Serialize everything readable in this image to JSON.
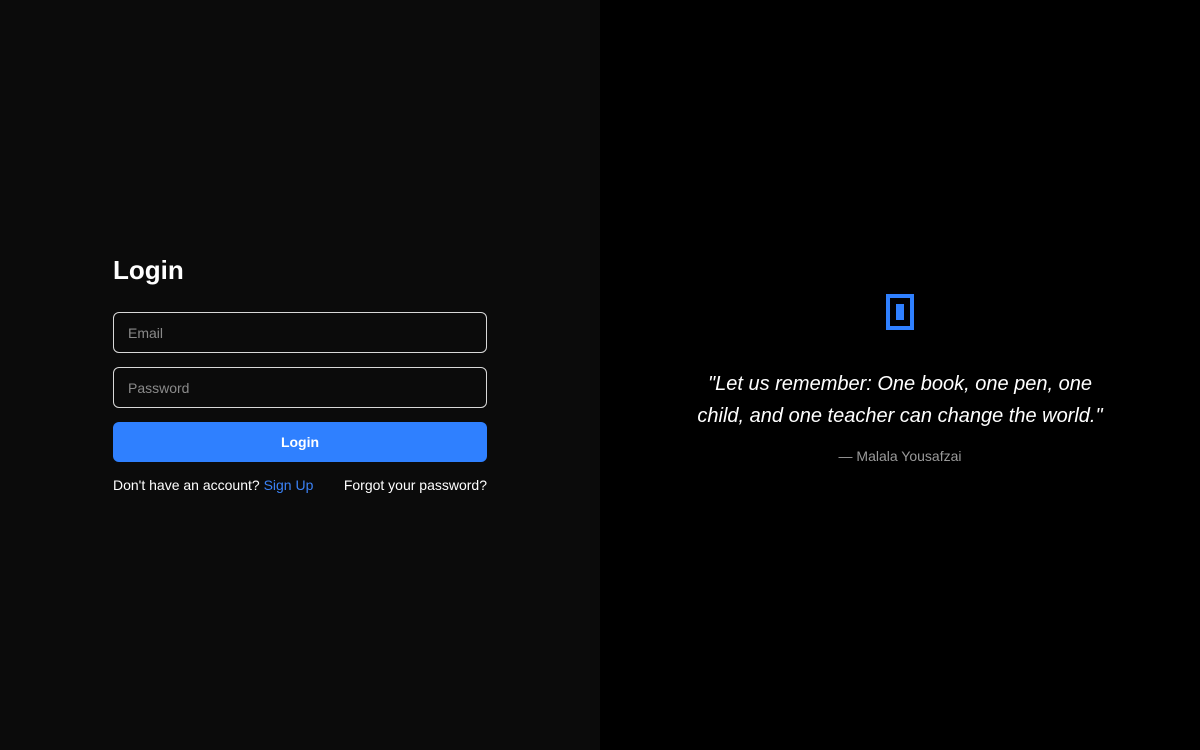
{
  "login": {
    "title": "Login",
    "email_placeholder": "Email",
    "password_placeholder": "Password",
    "submit_label": "Login",
    "no_account_text": "Don't have an account?",
    "signup_label": "Sign Up",
    "forgot_label": "Forgot your password?"
  },
  "quote": {
    "logo_icon": "bookmark-logo-icon",
    "text": "\"Let us remember: One book, one pen, one child, and one teacher can change the world.\"",
    "author": "— Malala Yousafzai"
  },
  "colors": {
    "accent": "#2f80ff",
    "left_bg": "#0b0b0b",
    "right_bg": "#000000",
    "link": "#3b82f6"
  }
}
